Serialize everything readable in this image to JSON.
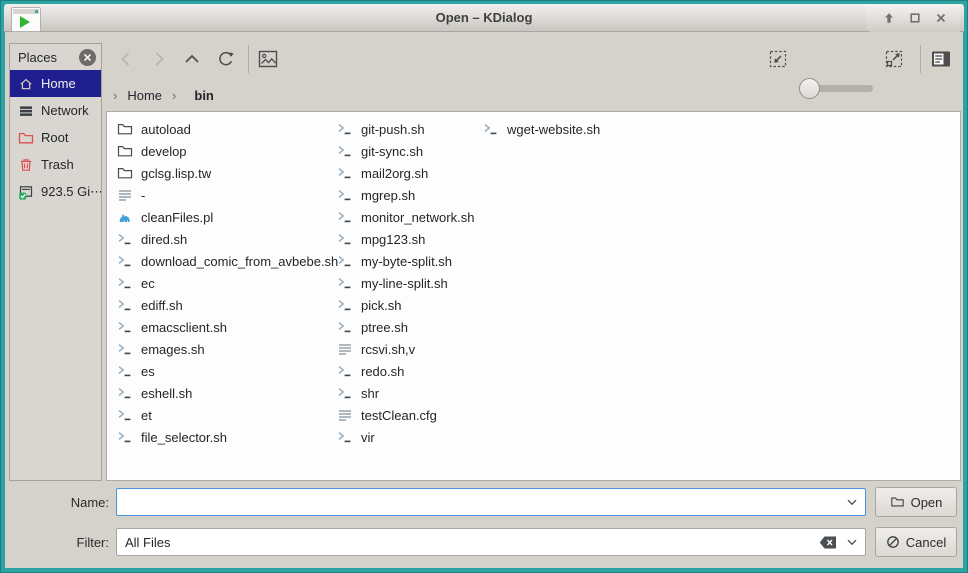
{
  "window": {
    "title": "Open – KDialog",
    "controls": {
      "minimize": "arrow-up-icon",
      "maximize": "square-icon",
      "close": "x-icon"
    }
  },
  "colors": {
    "frame_teal": "#2fa3a3",
    "selection_navy": "#1e1e8f",
    "focus_blue": "#4a90d9",
    "dialog_bg": "#d5d2cc",
    "panel_bg": "#fdfdfd",
    "script_chevron": "#9bb1c1",
    "perl_blue": "#3f9fd8",
    "danger_red": "#e04f4f",
    "emblem_green": "#27ae60"
  },
  "sidebar": {
    "header": "Places",
    "close_icon": "close-circle-icon",
    "items": [
      {
        "id": "home",
        "label": "Home",
        "icon": "home",
        "selected": true
      },
      {
        "id": "network",
        "label": "Network",
        "icon": "network",
        "selected": false
      },
      {
        "id": "root",
        "label": "Root",
        "icon": "folder-red",
        "selected": false
      },
      {
        "id": "trash",
        "label": "Trash",
        "icon": "trash",
        "selected": false
      },
      {
        "id": "drive",
        "label": "923.5 Gi⋯",
        "icon": "drive",
        "selected": false
      }
    ]
  },
  "toolbar": {
    "icons": [
      "back-icon",
      "forward-icon",
      "up-icon",
      "reload-icon",
      "preview-icon",
      "zoom-out-icon",
      "zoom-slider",
      "zoom-in-icon",
      "detail-view-icon"
    ]
  },
  "breadcrumb": {
    "leading_chevron": "›",
    "separator": "›",
    "home": "Home",
    "current": "bin"
  },
  "files": {
    "columns": [
      [
        {
          "name": "autoload",
          "icon": "folder"
        },
        {
          "name": "develop",
          "icon": "folder"
        },
        {
          "name": "gclsg.lisp.tw",
          "icon": "folder"
        },
        {
          "name": "-",
          "icon": "text"
        },
        {
          "name": "cleanFiles.pl",
          "icon": "perl"
        },
        {
          "name": "dired.sh",
          "icon": "script"
        },
        {
          "name": "download_comic_from_avbebe.sh",
          "icon": "script"
        },
        {
          "name": "ec",
          "icon": "script"
        },
        {
          "name": "ediff.sh",
          "icon": "script"
        },
        {
          "name": "emacsclient.sh",
          "icon": "script"
        },
        {
          "name": "emages.sh",
          "icon": "script"
        },
        {
          "name": "es",
          "icon": "script"
        },
        {
          "name": "eshell.sh",
          "icon": "script"
        },
        {
          "name": "et",
          "icon": "script"
        },
        {
          "name": "file_selector.sh",
          "icon": "script"
        }
      ],
      [
        {
          "name": "git-push.sh",
          "icon": "script"
        },
        {
          "name": "git-sync.sh",
          "icon": "script"
        },
        {
          "name": "mail2org.sh",
          "icon": "script"
        },
        {
          "name": "mgrep.sh",
          "icon": "script"
        },
        {
          "name": "monitor_network.sh",
          "icon": "script"
        },
        {
          "name": "mpg123.sh",
          "icon": "script"
        },
        {
          "name": "my-byte-split.sh",
          "icon": "script"
        },
        {
          "name": "my-line-split.sh",
          "icon": "script"
        },
        {
          "name": "pick.sh",
          "icon": "script"
        },
        {
          "name": "ptree.sh",
          "icon": "script"
        },
        {
          "name": "rcsvi.sh,v",
          "icon": "text"
        },
        {
          "name": "redo.sh",
          "icon": "script"
        },
        {
          "name": "shr",
          "icon": "script"
        },
        {
          "name": "testClean.cfg",
          "icon": "text"
        },
        {
          "name": "vir",
          "icon": "script"
        }
      ],
      [
        {
          "name": "wget-website.sh",
          "icon": "script"
        }
      ]
    ]
  },
  "form": {
    "name_label": "Name:",
    "name_value": "",
    "filter_label": "Filter:",
    "filter_value": "All Files",
    "open_label": "Open",
    "cancel_label": "Cancel"
  }
}
